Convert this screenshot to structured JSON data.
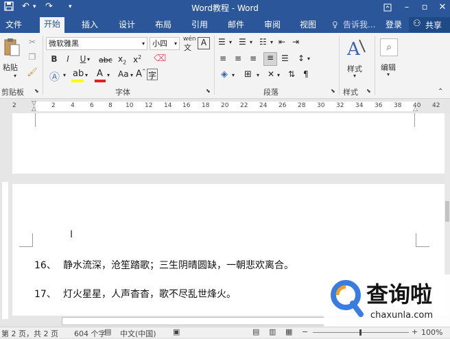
{
  "window": {
    "title": "Word教程 - Word"
  },
  "quick_access": {
    "undo": "↶",
    "redo": "↷",
    "customize": "▾"
  },
  "tabs": [
    "文件",
    "开始",
    "插入",
    "设计",
    "布局",
    "引用",
    "邮件",
    "审阅",
    "视图"
  ],
  "tell_me": "告诉我...",
  "signin": "登录",
  "share": "共享",
  "ribbon": {
    "clipboard": {
      "paste": "粘贴",
      "group": "剪贴板"
    },
    "font": {
      "name": "微软雅黑",
      "size": "小四",
      "group": "字体",
      "wen": "wén"
    },
    "paragraph": {
      "group": "段落"
    },
    "styles": {
      "label": "样式",
      "group": "样式"
    },
    "editing": {
      "label": "编辑"
    }
  },
  "ruler": {
    "ticks": [
      "2",
      "2",
      "4",
      "6",
      "8",
      "10",
      "12",
      "14",
      "16",
      "18",
      "20",
      "22",
      "24",
      "26",
      "28",
      "30",
      "32",
      "34",
      "36",
      "38",
      "40",
      "42"
    ]
  },
  "document": {
    "lines": [
      {
        "num": "16、",
        "text": "静水流深，沧笙踏歌；三生阴晴圆缺，一朝悲欢离合。"
      },
      {
        "num": "17、",
        "text": "灯火星星，人声杳杳，歌不尽乱世烽火。"
      }
    ]
  },
  "status": {
    "page": "第 2 页，共 2 页",
    "words": "604 个字",
    "lang": "中文(中国)",
    "zoom": "100%"
  },
  "watermark": {
    "brand": "查询啦",
    "url": "chaxunla.com"
  },
  "colors": {
    "accent": "#2b579a",
    "highlight": "#ffff00",
    "font_color": "#e02020",
    "watermark_blue": "#3a7de0",
    "watermark_orange": "#f4a020"
  }
}
